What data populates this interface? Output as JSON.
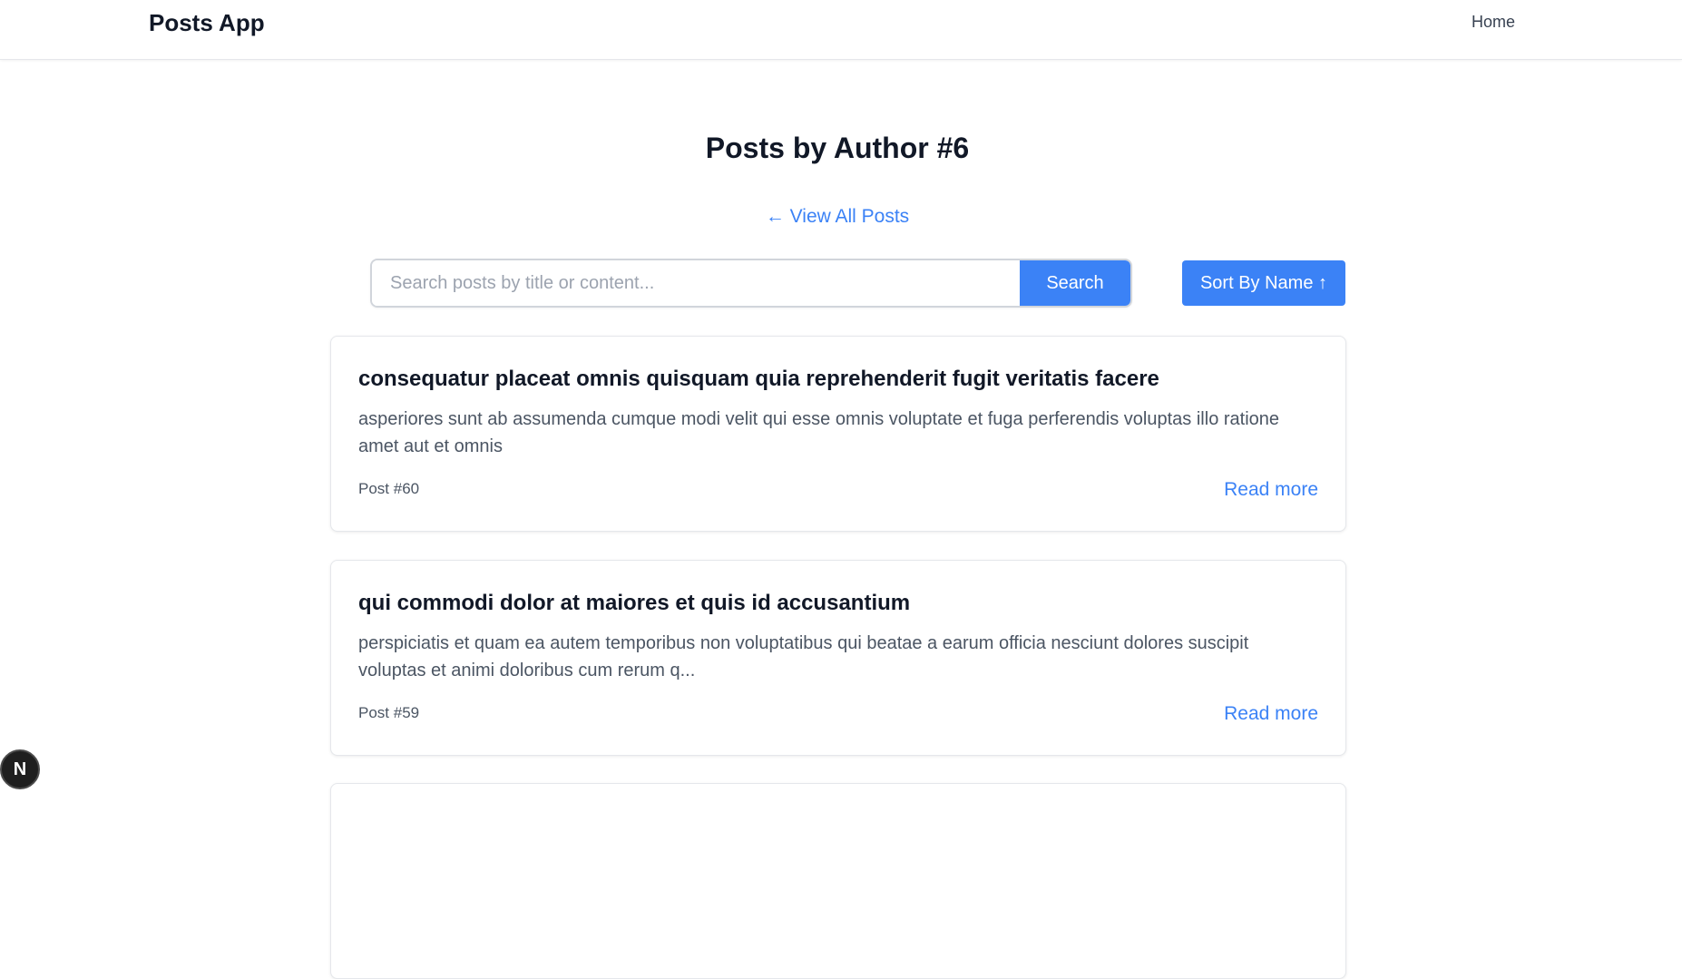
{
  "navbar": {
    "brand": "Posts App",
    "home_link": "Home"
  },
  "page": {
    "title": "Posts by Author #6",
    "back_link": "← View All Posts"
  },
  "search": {
    "placeholder": "Search posts by title or content...",
    "value": "",
    "button_label": "Search"
  },
  "sort": {
    "label": "Sort By Name ↑"
  },
  "posts": [
    {
      "title": "consequatur placeat omnis quisquam quia reprehenderit fugit veritatis facere",
      "body": "asperiores sunt ab assumenda cumque modi velit qui esse omnis voluptate et fuga perferendis voluptas illo ratione amet aut et omnis",
      "id_label": "Post #60",
      "read_more": "Read more"
    },
    {
      "title": "qui commodi dolor at maiores et quis id accusantium",
      "body": "perspiciatis et quam ea autem temporibus non voluptatibus qui beatae a earum officia nesciunt dolores suscipit voluptas et animi doloribus cum rerum q...",
      "id_label": "Post #59",
      "read_more": "Read more"
    }
  ],
  "dev_badge": {
    "icon": "nextjs-logo-icon",
    "letter": "N"
  },
  "colors": {
    "accent": "#3b82f6",
    "text_primary": "#111827",
    "text_secondary": "#4b5563",
    "border": "#e5e7eb"
  }
}
